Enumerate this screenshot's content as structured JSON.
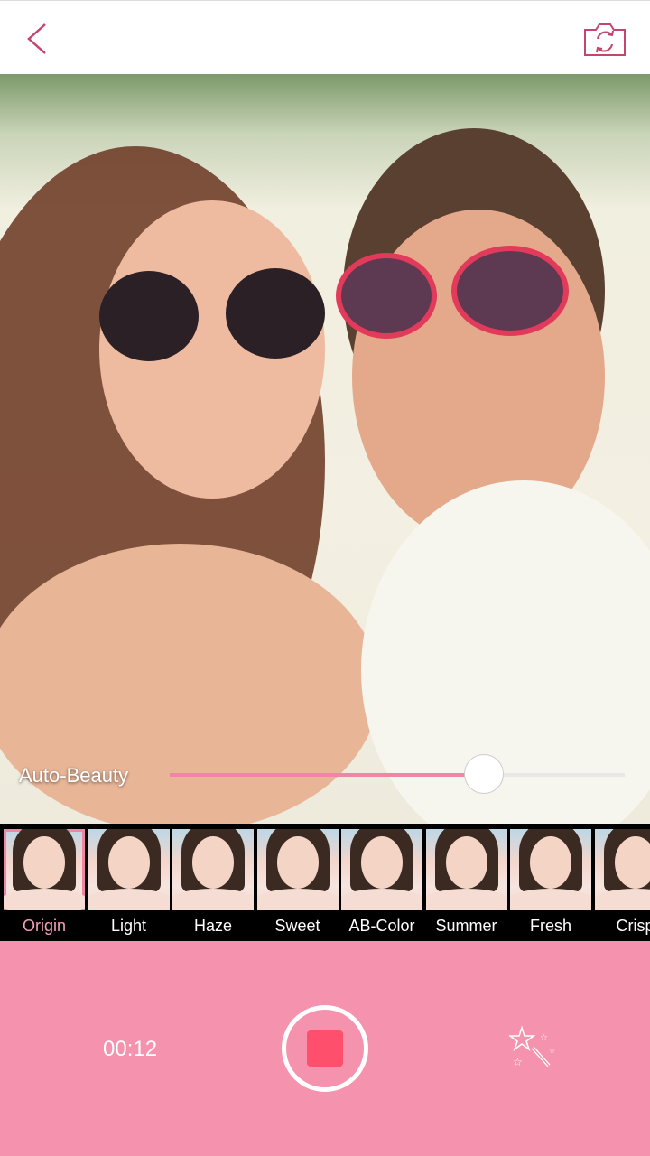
{
  "topbar": {
    "back_icon": "chevron-left-icon",
    "switch_camera_icon": "camera-switch-icon",
    "icon_color": "#c2466e"
  },
  "preview": {
    "beauty_label": "Auto-Beauty",
    "beauty_level": 0.69
  },
  "filters": [
    {
      "label": "Origin",
      "selected": true
    },
    {
      "label": "Light"
    },
    {
      "label": "Haze"
    },
    {
      "label": "Sweet"
    },
    {
      "label": "AB-Color"
    },
    {
      "label": "Summer"
    },
    {
      "label": "Fresh"
    },
    {
      "label": "Crisp"
    }
  ],
  "controls": {
    "timer": "00:12",
    "record_icon": "stop-icon",
    "effects_icon": "magic-wand-icon"
  },
  "colors": {
    "accent": "#f592ad",
    "stop": "#fe506c",
    "slider": "#ef86a6"
  }
}
